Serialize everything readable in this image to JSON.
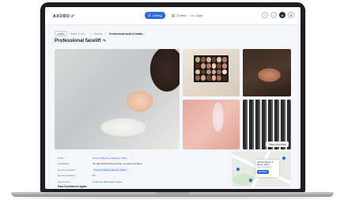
{
  "nav": {
    "logo": "AXORO",
    "logo_mark": "✔",
    "items": [
      {
        "label": "Listing",
        "icon": "list-icon"
      },
      {
        "label": "Orders",
        "icon": "orders-icon"
      },
      {
        "label": "Chat",
        "icon": "chat-icon"
      }
    ]
  },
  "breadcrumb": {
    "back": "◂ Back",
    "items": [
      "Health & Lea…",
      "Beauty"
    ],
    "current": "Professional facial & treatm…"
  },
  "page": {
    "title": "Professional facelift",
    "show_all": "Show all photos"
  },
  "info_rows": [
    {
      "key": "Seller",
      "value": "Cloud & Beauty & Beauty Salon"
    },
    {
      "key": "Availability",
      "value": "On-demand booking online, at expert location"
    },
    {
      "key": "Service location",
      "value": "Cloud & Beauty Beauty Salon"
    },
    {
      "key": "Service duration",
      "value": "1h"
    },
    {
      "key": "Service fee",
      "value": "Cosmetic Massages Online"
    }
  ],
  "section_heading": "Fast Confidence Again",
  "map": {
    "card_title": "Cloud & Beauty & Beauty Salon",
    "card_sub": "Service location",
    "card_button": "Directions"
  },
  "colors": {
    "accent": "#2f6bd8",
    "background": "#f4f6fa"
  }
}
